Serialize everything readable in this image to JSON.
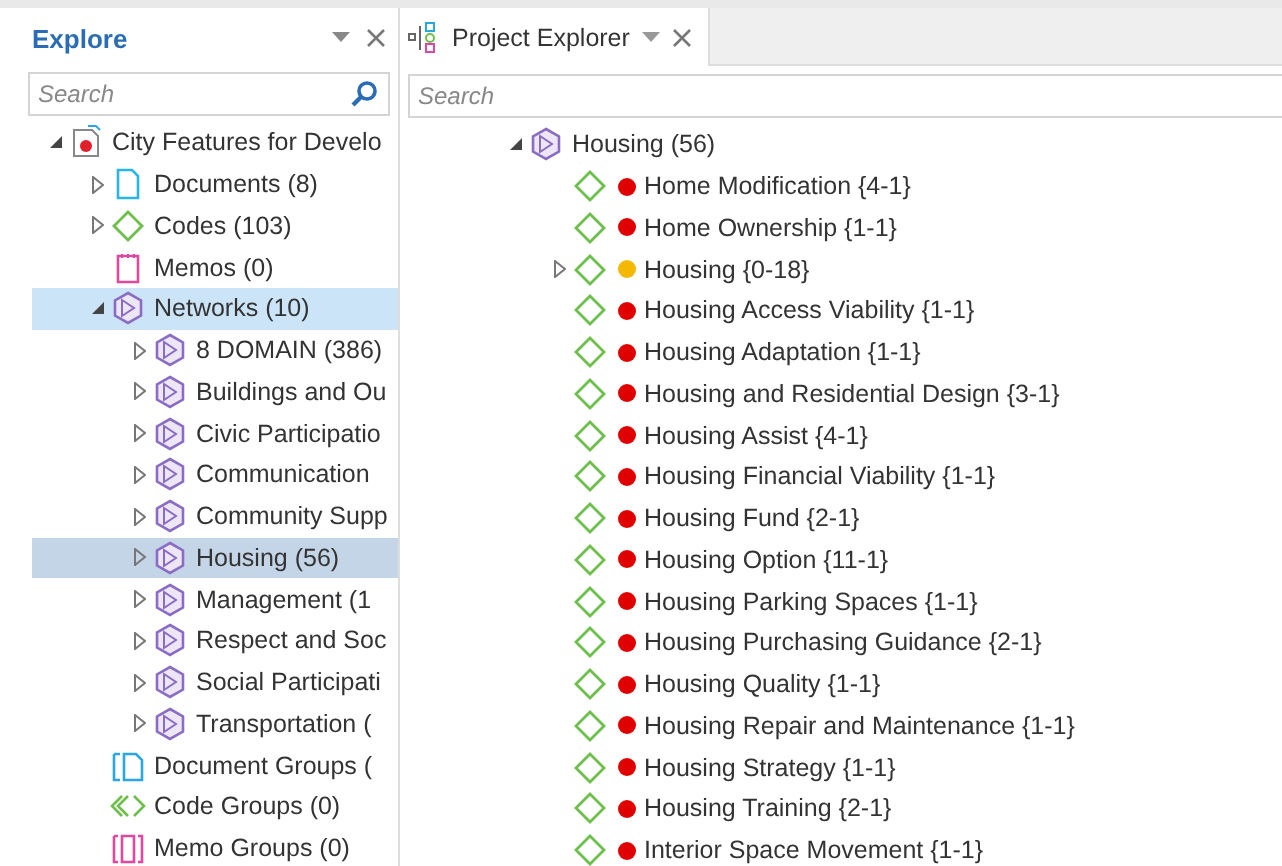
{
  "explore": {
    "title": "Explore",
    "search": {
      "placeholder": "Search"
    },
    "tree": [
      {
        "kind": "project",
        "label": "City Features for Develo",
        "expanded": true,
        "selected": false,
        "focused": false,
        "children": [
          {
            "kind": "documents",
            "label": "Documents (8)",
            "expanded": false,
            "selected": false,
            "focused": false
          },
          {
            "kind": "codes",
            "label": "Codes (103)",
            "expanded": false,
            "selected": false,
            "focused": false
          },
          {
            "kind": "memos",
            "label": "Memos (0)",
            "selected": false,
            "focused": false
          },
          {
            "kind": "network",
            "label": "Networks (10)",
            "expanded": true,
            "selected": false,
            "focused": true,
            "children": [
              {
                "kind": "network",
                "label": "8 DOMAIN (386)",
                "expanded": false,
                "selected": false,
                "focused": false
              },
              {
                "kind": "network",
                "label": "Buildings and Ou",
                "expanded": false,
                "selected": false,
                "focused": false
              },
              {
                "kind": "network",
                "label": "Civic Participatio",
                "expanded": false,
                "selected": false,
                "focused": false
              },
              {
                "kind": "network",
                "label": "Communication",
                "expanded": false,
                "selected": false,
                "focused": false
              },
              {
                "kind": "network",
                "label": "Community Supp",
                "expanded": false,
                "selected": false,
                "focused": false
              },
              {
                "kind": "network",
                "label": "Housing (56)",
                "expanded": false,
                "selected": true,
                "focused": false
              },
              {
                "kind": "network",
                "label": "Management (1",
                "expanded": false,
                "selected": false,
                "focused": false
              },
              {
                "kind": "network",
                "label": "Respect and Soc",
                "expanded": false,
                "selected": false,
                "focused": false
              },
              {
                "kind": "network",
                "label": "Social Participati",
                "expanded": false,
                "selected": false,
                "focused": false
              },
              {
                "kind": "network",
                "label": "Transportation (",
                "expanded": false,
                "selected": false,
                "focused": false
              }
            ]
          },
          {
            "kind": "document-groups",
            "label": "Document Groups (",
            "selected": false,
            "focused": false
          },
          {
            "kind": "code-groups",
            "label": "Code Groups (0)",
            "selected": false,
            "focused": false
          },
          {
            "kind": "memo-groups",
            "label": "Memo Groups (0)",
            "selected": false,
            "focused": false
          }
        ]
      }
    ]
  },
  "project_explorer": {
    "tab": "Project Explorer",
    "search": {
      "placeholder": "Search"
    },
    "root": {
      "label": "Housing (56)",
      "expanded": true,
      "children": [
        {
          "label": "Home Modification {4-1}",
          "color": "#e00000"
        },
        {
          "label": "Home Ownership {1-1}",
          "color": "#e00000"
        },
        {
          "label": "Housing {0-18}",
          "color": "#f5b800",
          "expanded": false
        },
        {
          "label": "Housing Access Viability {1-1}",
          "color": "#e00000"
        },
        {
          "label": "Housing Adaptation {1-1}",
          "color": "#e00000"
        },
        {
          "label": "Housing and Residential Design {3-1}",
          "color": "#e00000"
        },
        {
          "label": "Housing Assist {4-1}",
          "color": "#e00000"
        },
        {
          "label": "Housing Financial Viability {1-1}",
          "color": "#e00000"
        },
        {
          "label": "Housing Fund {2-1}",
          "color": "#e00000"
        },
        {
          "label": "Housing Option {11-1}",
          "color": "#e00000"
        },
        {
          "label": "Housing Parking Spaces {1-1}",
          "color": "#e00000"
        },
        {
          "label": "Housing Purchasing Guidance {2-1}",
          "color": "#e00000"
        },
        {
          "label": "Housing Quality {1-1}",
          "color": "#e00000"
        },
        {
          "label": "Housing Repair and Maintenance {1-1}",
          "color": "#e00000"
        },
        {
          "label": "Housing Strategy {1-1}",
          "color": "#e00000"
        },
        {
          "label": "Housing Training {2-1}",
          "color": "#e00000"
        },
        {
          "label": "Interior Space Movement {1-1}",
          "color": "#e00000"
        }
      ]
    }
  }
}
